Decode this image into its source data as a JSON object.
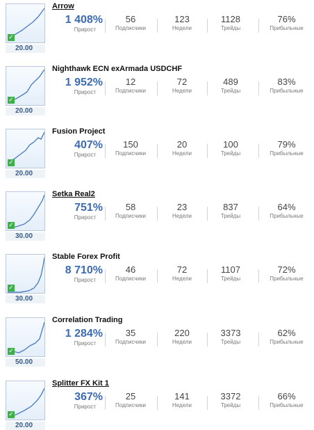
{
  "labels": {
    "growth": "Прирост",
    "subscribers": "Подписчики",
    "weeks": "Недели",
    "trades": "Трейды",
    "profitable": "Прибыльные"
  },
  "signals": [
    {
      "name": "Arrow",
      "link": true,
      "price": "20.00",
      "growth": "1 408%",
      "subscribers": "56",
      "weeks": "123",
      "trades": "1128",
      "profitable": "76%"
    },
    {
      "name": "Nighthawk ECN exArmada USDCHF",
      "link": false,
      "price": "20.00",
      "growth": "1 952%",
      "subscribers": "12",
      "weeks": "72",
      "trades": "489",
      "profitable": "83%"
    },
    {
      "name": "Fusion Project",
      "link": false,
      "price": "20.00",
      "growth": "407%",
      "subscribers": "150",
      "weeks": "20",
      "trades": "100",
      "profitable": "79%"
    },
    {
      "name": "Setka Real2",
      "link": true,
      "price": "30.00",
      "growth": "751%",
      "subscribers": "58",
      "weeks": "23",
      "trades": "837",
      "profitable": "64%"
    },
    {
      "name": "Stable Forex Profit",
      "link": false,
      "price": "30.00",
      "growth": "8 710%",
      "subscribers": "46",
      "weeks": "72",
      "trades": "1107",
      "profitable": "72%"
    },
    {
      "name": "Correlation Trading",
      "link": false,
      "price": "50.00",
      "growth": "1 284%",
      "subscribers": "35",
      "weeks": "220",
      "trades": "3373",
      "profitable": "62%"
    },
    {
      "name": "Splitter FX Kit 1",
      "link": true,
      "price": "20.00",
      "growth": "367%",
      "subscribers": "25",
      "weeks": "141",
      "trades": "3372",
      "profitable": "66%"
    }
  ],
  "icons": {
    "verified": "check-icon"
  },
  "colors": {
    "growth": "#3d6bb1",
    "chart_line": "#4f7fc0",
    "verified": "#3db04a"
  }
}
